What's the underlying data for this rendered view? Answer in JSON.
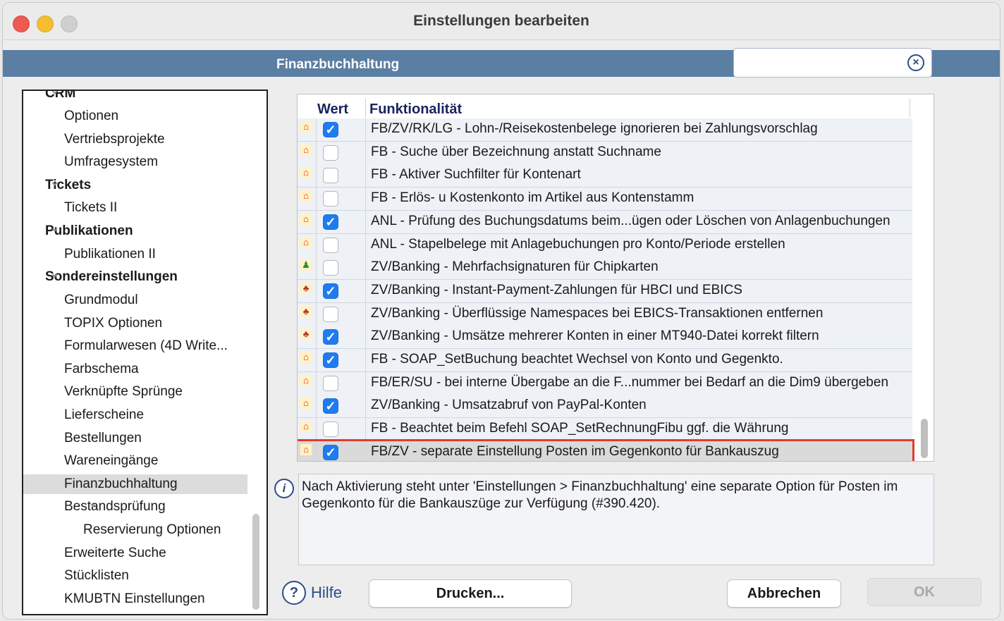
{
  "window": {
    "title": "Einstellungen bearbeiten"
  },
  "header": {
    "section_title": "Finanzbuchhaltung",
    "search": {
      "value": "",
      "placeholder": ""
    }
  },
  "tree": {
    "items": [
      {
        "label": "CRM",
        "level": 0,
        "expanded": true,
        "bold": true
      },
      {
        "label": "Optionen",
        "level": 1
      },
      {
        "label": "Vertriebsprojekte",
        "level": 1
      },
      {
        "label": "Umfragesystem",
        "level": 1
      },
      {
        "label": "Tickets",
        "level": 0,
        "expanded": true,
        "bold": true
      },
      {
        "label": "Tickets II",
        "level": 1
      },
      {
        "label": "Publikationen",
        "level": 0,
        "expanded": true,
        "bold": true
      },
      {
        "label": "Publikationen II",
        "level": 1
      },
      {
        "label": "Sondereinstellungen",
        "level": 0,
        "expanded": true,
        "bold": true
      },
      {
        "label": "Grundmodul",
        "level": 1
      },
      {
        "label": "TOPIX Optionen",
        "level": 1
      },
      {
        "label": "Formularwesen (4D Write...",
        "level": 1
      },
      {
        "label": "Farbschema",
        "level": 1
      },
      {
        "label": "Verknüpfte Sprünge",
        "level": 1
      },
      {
        "label": "Lieferscheine",
        "level": 1
      },
      {
        "label": "Bestellungen",
        "level": 1
      },
      {
        "label": "Wareneingänge",
        "level": 1
      },
      {
        "label": "Finanzbuchhaltung",
        "level": 1,
        "selected": true
      },
      {
        "label": "Bestandsprüfung",
        "level": 1,
        "expanded": true
      },
      {
        "label": "Reservierung Optionen",
        "level": 2
      },
      {
        "label": "Erweiterte Suche",
        "level": 1
      },
      {
        "label": "Stücklisten",
        "level": 1
      },
      {
        "label": "KMUBTN Einstellungen",
        "level": 1
      }
    ]
  },
  "grid": {
    "columns": {
      "wert": "Wert",
      "funktion": "Funktionalität"
    },
    "rows": [
      {
        "icon": "house-icon",
        "checked": true,
        "text": "FB/ZV/RK/LG - Lohn-/Reisekostenbelege ignorieren bei Zahlungsvorschlag"
      },
      {
        "icon": "house-icon",
        "checked": false,
        "text": "FB - Suche über Bezeichnung anstatt Suchname"
      },
      {
        "icon": "house-icon",
        "checked": false,
        "text": "FB - Aktiver Suchfilter für Kontenart"
      },
      {
        "icon": "house-icon",
        "checked": false,
        "text": "FB - Erlös- u Kostenkonto im Artikel aus Kontenstamm"
      },
      {
        "icon": "house-icon",
        "checked": true,
        "text": "ANL - Prüfung des Buchungsdatums beim...ügen oder Löschen von Anlagenbuchungen"
      },
      {
        "icon": "house-icon",
        "checked": false,
        "text": "ANL - Stapelbelege mit Anlagebuchungen pro Konto/Periode erstellen"
      },
      {
        "icon": "person-icon",
        "checked": false,
        "text": "ZV/Banking - Mehrfachsignaturen für Chipkarten"
      },
      {
        "icon": "network-icon",
        "checked": true,
        "text": "ZV/Banking - Instant-Payment-Zahlungen für HBCI und EBICS"
      },
      {
        "icon": "network-icon",
        "checked": false,
        "text": "ZV/Banking - Überflüssige Namespaces bei EBICS-Transaktionen entfernen"
      },
      {
        "icon": "network-icon",
        "checked": true,
        "text": "ZV/Banking - Umsätze mehrerer Konten in einer MT940-Datei korrekt filtern"
      },
      {
        "icon": "house-icon",
        "checked": true,
        "text": "FB - SOAP_SetBuchung beachtet Wechsel von Konto und Gegenkto."
      },
      {
        "icon": "house-icon",
        "checked": false,
        "text": "FB/ER/SU - bei interne Übergabe an die F...nummer bei Bedarf an die Dim9 übergeben"
      },
      {
        "icon": "house-icon",
        "checked": true,
        "text": "ZV/Banking - Umsatzabruf von PayPal-Konten"
      },
      {
        "icon": "house-icon",
        "checked": false,
        "text": "FB - Beachtet beim Befehl SOAP_SetRechnungFibu ggf. die Währung"
      },
      {
        "icon": "house-icon",
        "checked": true,
        "text": "FB/ZV - separate Einstellung Posten im Gegenkonto für Bankauszug",
        "highlighted": true
      }
    ]
  },
  "info": {
    "text": "Nach Aktivierung steht unter 'Einstellungen > Finanzbuchhaltung' eine separate Option für Posten im Gegenkonto für die Bankauszüge zur Verfügung (#390.420)."
  },
  "footer": {
    "help_label": "Hilfe",
    "print_label": "Drucken...",
    "cancel_label": "Abbrechen",
    "ok_label": "OK"
  },
  "colors": {
    "accent": "#1f7bf0",
    "header": "#5b7ea3",
    "highlight_border": "#e23b2e"
  }
}
